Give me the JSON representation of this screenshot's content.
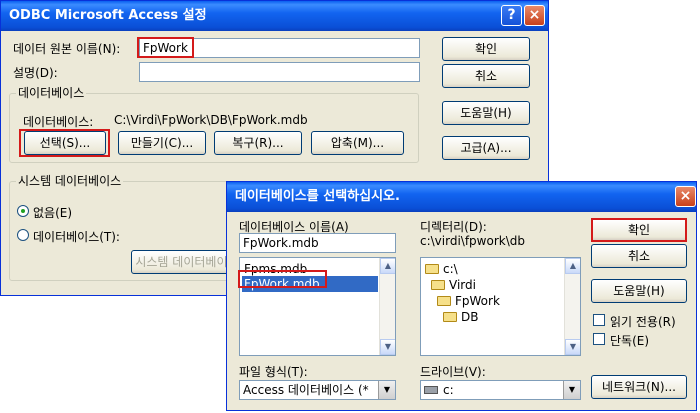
{
  "main_dialog": {
    "title": "ODBC Microsoft Access 설정",
    "help_btn": "?",
    "close_btn": "×",
    "dsn_label": "데이터 원본 이름(N):",
    "dsn_value": "FpWork",
    "desc_label": "설명(D):",
    "desc_value": "",
    "ok": "확인",
    "cancel": "취소",
    "help": "도움말(H)",
    "advanced": "고급(A)...",
    "db_group": "데이터베이스",
    "db_label": "데이터베이스:",
    "db_path": "C:\\Virdi\\FpWork\\DB\\FpWork.mdb",
    "select": "선택(S)...",
    "create": "만들기(C)...",
    "repair": "복구(R)...",
    "compact": "압축(M)...",
    "sysdb_group": "시스템 데이터베이스",
    "none": "없음(E)",
    "database": "데이터베이스(T):",
    "sysdb_button": "시스템 데이터베이스(Y)..."
  },
  "select_dialog": {
    "title": "데이터베이스를 선택하십시오.",
    "close_btn": "×",
    "dbname_label": "데이터베이스 이름(A)",
    "dbname_value": "FpWork.mdb",
    "files": [
      "Fpms.mdb",
      "FpWork.mdb"
    ],
    "dir_label": "디렉터리(D):",
    "dir_value": "c:\\virdi\\fpwork\\db",
    "tree": [
      "c:\\",
      "Virdi",
      "FpWork",
      "DB"
    ],
    "ok": "확인",
    "cancel": "취소",
    "help": "도움말(H)",
    "readonly": "읽기 전용(R)",
    "exclusive": "단독(E)",
    "filetype_label": "파일 형식(T):",
    "filetype_value": "Access 데이터베이스 (*",
    "drive_label": "드라이브(V):",
    "drive_value": "c:",
    "network": "네트워크(N)..."
  },
  "icons": {
    "folder": "folder-icon",
    "drive": "drive-icon"
  },
  "colors": {
    "titlebar": "#0a5ff0",
    "dialog_bg": "#ece9d8",
    "highlight_box": "#d41a1a",
    "selection": "#316ac5"
  }
}
